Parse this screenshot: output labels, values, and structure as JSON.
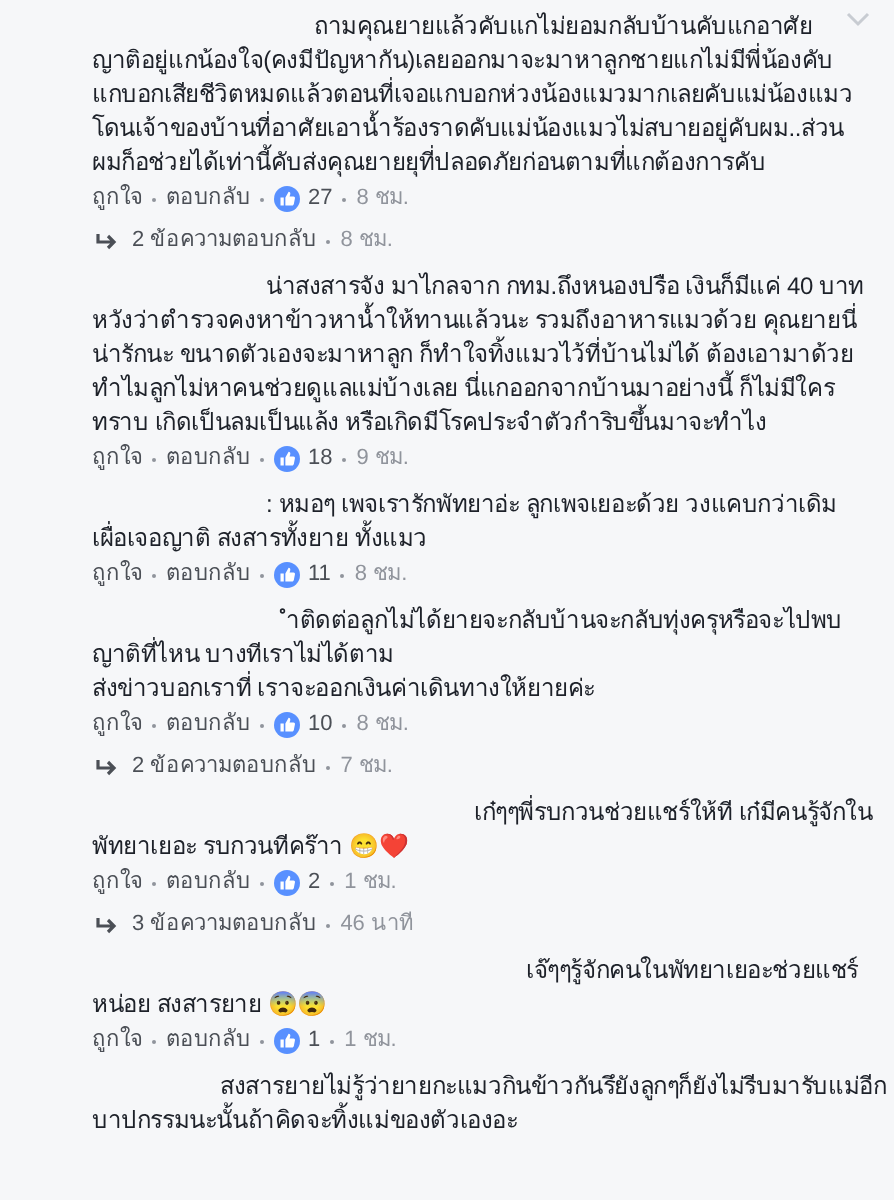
{
  "comments": [
    {
      "text": "ถามคุณยายแล้วคับแกไม่ยอมกลับบ้านคับแกอาศัยญาติอยู่แกน้องใจ(คงมีปัญหากัน)เลยออกมาจะมาหาลูกชายแกไม่มีพี่น้องคับแกบอกเสียชีวิตหมดแล้วตอนที่เจอแกบอกห่วงน้องแมวมากเลยคับแม่น้องแมวโดนเจ้าของบ้านที่อาศัยเอาน้ำร้องราดคับแม่น้องแมวไม่สบายอยู่คับผม..ส่วนผมก็อช่วยได้เท่านี้คับส่งคุณยายยุที่ปลอดภัยก่อนตามที่แกต้องการคับ",
      "like": "ถูกใจ",
      "reply": "ตอบกลับ",
      "reactions": "27",
      "time": "8 ชม.",
      "replies": {
        "label": "2 ข้อความตอบกลับ",
        "time": "8 ชม."
      }
    },
    {
      "text": "น่าสงสารจัง มาไกลจาก กทม.ถึงหนองปรือ เงินก็มีแค่ 40 บาท หวังว่าตำรวจคงหาข้าวหาน้ำให้ทานแล้วนะ รวมถึงอาหารแมวด้วย คุณยายนี่น่ารักนะ ขนาดตัวเองจะมาหาลูก ก็ทำใจทิ้งแมวไว้ที่บ้านไม่ได้ ต้องเอามาด้วย ทำไมลูกไม่หาคนช่วยดูแลแม่บ้างเลย นี่แกออกจากบ้านมาอย่างนี้ ก็ไม่มีใครทราบ เกิดเป็นลมเป็นแล้ง หรือเกิดมีโรคประจำตัวกำริบขึ้นมาจะทำไง",
      "like": "ถูกใจ",
      "reply": "ตอบกลับ",
      "reactions": "18",
      "time": "9 ชม."
    },
    {
      "text": ": หมอๆ เพจเรารักพัทยาอ่ะ ลูกเพจเยอะด้วย วงแคบกว่าเดิม เผื่อเจอญาติ สงสารทั้งยาย ทั้งแมว",
      "like": "ถูกใจ",
      "reply": "ตอบกลับ",
      "reactions": "11",
      "time": "8 ชม."
    },
    {
      "text": "ำติดต่อลูกไม่ได้ยายจะกลับบ้านจะกลับทุ่งครุหรือจะไปพบญาติที่ไหน บางทีเราไม่ได้ตาม\nส่งข่าวบอกเราที่ เราจะออกเงินค่าเดินทางให้ยายค่ะ",
      "like": "ถูกใจ",
      "reply": "ตอบกลับ",
      "reactions": "10",
      "time": "8 ชม.",
      "replies": {
        "label": "2 ข้อความตอบกลับ",
        "time": "7 ชม."
      }
    },
    {
      "text": "เก๋ๆๆพี่รบกวนช่วยแชร์ให้ที เก๋มีคนรู้จักในพัทยาเยอะ รบกวนทีคร๊าา 😁❤️",
      "like": "ถูกใจ",
      "reply": "ตอบกลับ",
      "reactions": "2",
      "time": "1 ชม.",
      "replies": {
        "label": "3 ข้อความตอบกลับ",
        "time": "46 นาที"
      }
    },
    {
      "text": "เจ๊ๆๆรู้จักคนในพัทยาเยอะช่วยแชร์หน่อย สงสารยาย 😨😨",
      "like": "ถูกใจ",
      "reply": "ตอบกลับ",
      "reactions": "1",
      "time": "1 ชม."
    },
    {
      "text": "สงสารยายไม่รู้ว่ายายกะแมวกินข้าวกันรึยังลูกๆก็ยังไม่รีบมารับแม่อีกบาปกรรมนะนั้นถ้าคิดจะทิ้งแม่ของตัวเองอะ"
    }
  ]
}
